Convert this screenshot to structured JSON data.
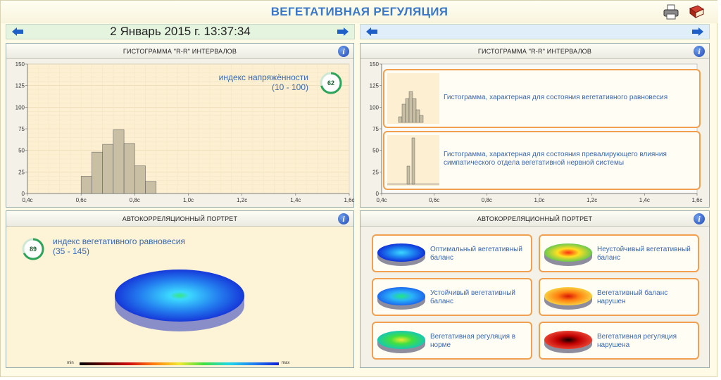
{
  "app": {
    "title": "ВЕГЕТАТИВНАЯ РЕГУЛЯЦИЯ",
    "icons": [
      "printer-icon",
      "book-icon"
    ]
  },
  "nav_left": {
    "datetime": "2 Январь 2015 г. 13:37:34",
    "icons": [
      "arrow-left-icon",
      "arrow-right-icon"
    ]
  },
  "nav_right": {
    "icons": [
      "arrow-left-icon",
      "arrow-right-icon"
    ]
  },
  "panel_tl": {
    "title": "ГИСТОГРАММА \"R-R\" ИНТЕРВАЛОВ",
    "index_label": "индекс напряжённости",
    "index_range": "(10 - 100)",
    "index_value": "62"
  },
  "panel_tr": {
    "title": "ГИСТОГРАММА \"R-R\" ИНТЕРВАЛОВ",
    "cards": [
      "Гистограмма, характерная для состояния вегетативного равновесия",
      "Гистограмма, характерная для состояния превалирующего влияния симпатического отдела вегетативной нервной системы"
    ]
  },
  "panel_bl": {
    "title": "АВТОКОРРЕЛЯЦИОННЫЙ ПОРТРЕТ",
    "index_label": "индекс вегетативного равновесия",
    "index_range": "(35 - 145)",
    "index_value": "89",
    "scale_min": "min",
    "scale_max": "max"
  },
  "panel_br": {
    "title": "АВТОКОРРЕЛЯЦИОННЫЙ ПОРТРЕТ",
    "cards": [
      {
        "label": "Оптимальный вегетативный баланс",
        "colors": [
          "#3bd8ff",
          "#1f8cf2",
          "#1030d8"
        ]
      },
      {
        "label": "Неустойчивый вегетативный баланс",
        "colors": [
          "#ff3010",
          "#ffe020",
          "#6ac850"
        ]
      },
      {
        "label": "Устойчивый вегетативный баланс",
        "colors": [
          "#20e880",
          "#2ab4f8",
          "#1c68ee"
        ]
      },
      {
        "label": "Вегетативный баланс нарушен",
        "colors": [
          "#d81808",
          "#ff8010",
          "#f8d040"
        ]
      },
      {
        "label": "Вегетативная регуляция в норме",
        "colors": [
          "#f0e830",
          "#40e040",
          "#18c8b0"
        ]
      },
      {
        "label": "Вегетативная регуляция нарушена",
        "colors": [
          "#100000",
          "#c00000",
          "#e84030"
        ]
      }
    ]
  },
  "chart_data": [
    {
      "type": "bar",
      "x": [
        0.6,
        0.64,
        0.68,
        0.72,
        0.76,
        0.8,
        0.84
      ],
      "values": [
        20,
        48,
        57,
        74,
        58,
        32,
        14
      ],
      "xlim": [
        0.4,
        1.6
      ],
      "ylim": [
        0,
        150
      ],
      "xticks": [
        "0,4c",
        "0,6c",
        "0,8c",
        "1,0c",
        "1,2c",
        "1,4c",
        "1,6c"
      ],
      "yticks": [
        "0",
        "25",
        "50",
        "75",
        "100",
        "125",
        "150"
      ],
      "grid": true,
      "color": "#c8bfa4"
    },
    {
      "type": "bar",
      "x": [],
      "values": [],
      "xlim": [
        0.4,
        1.6
      ],
      "ylim": [
        0,
        150
      ],
      "xticks": [
        "0,4c",
        "0,6c",
        "0,8c",
        "1,0c",
        "1,2c",
        "1,4c",
        "1,6c"
      ],
      "yticks": [
        "0",
        "25",
        "50",
        "75",
        "100",
        "125",
        "150"
      ],
      "grid": false
    }
  ]
}
